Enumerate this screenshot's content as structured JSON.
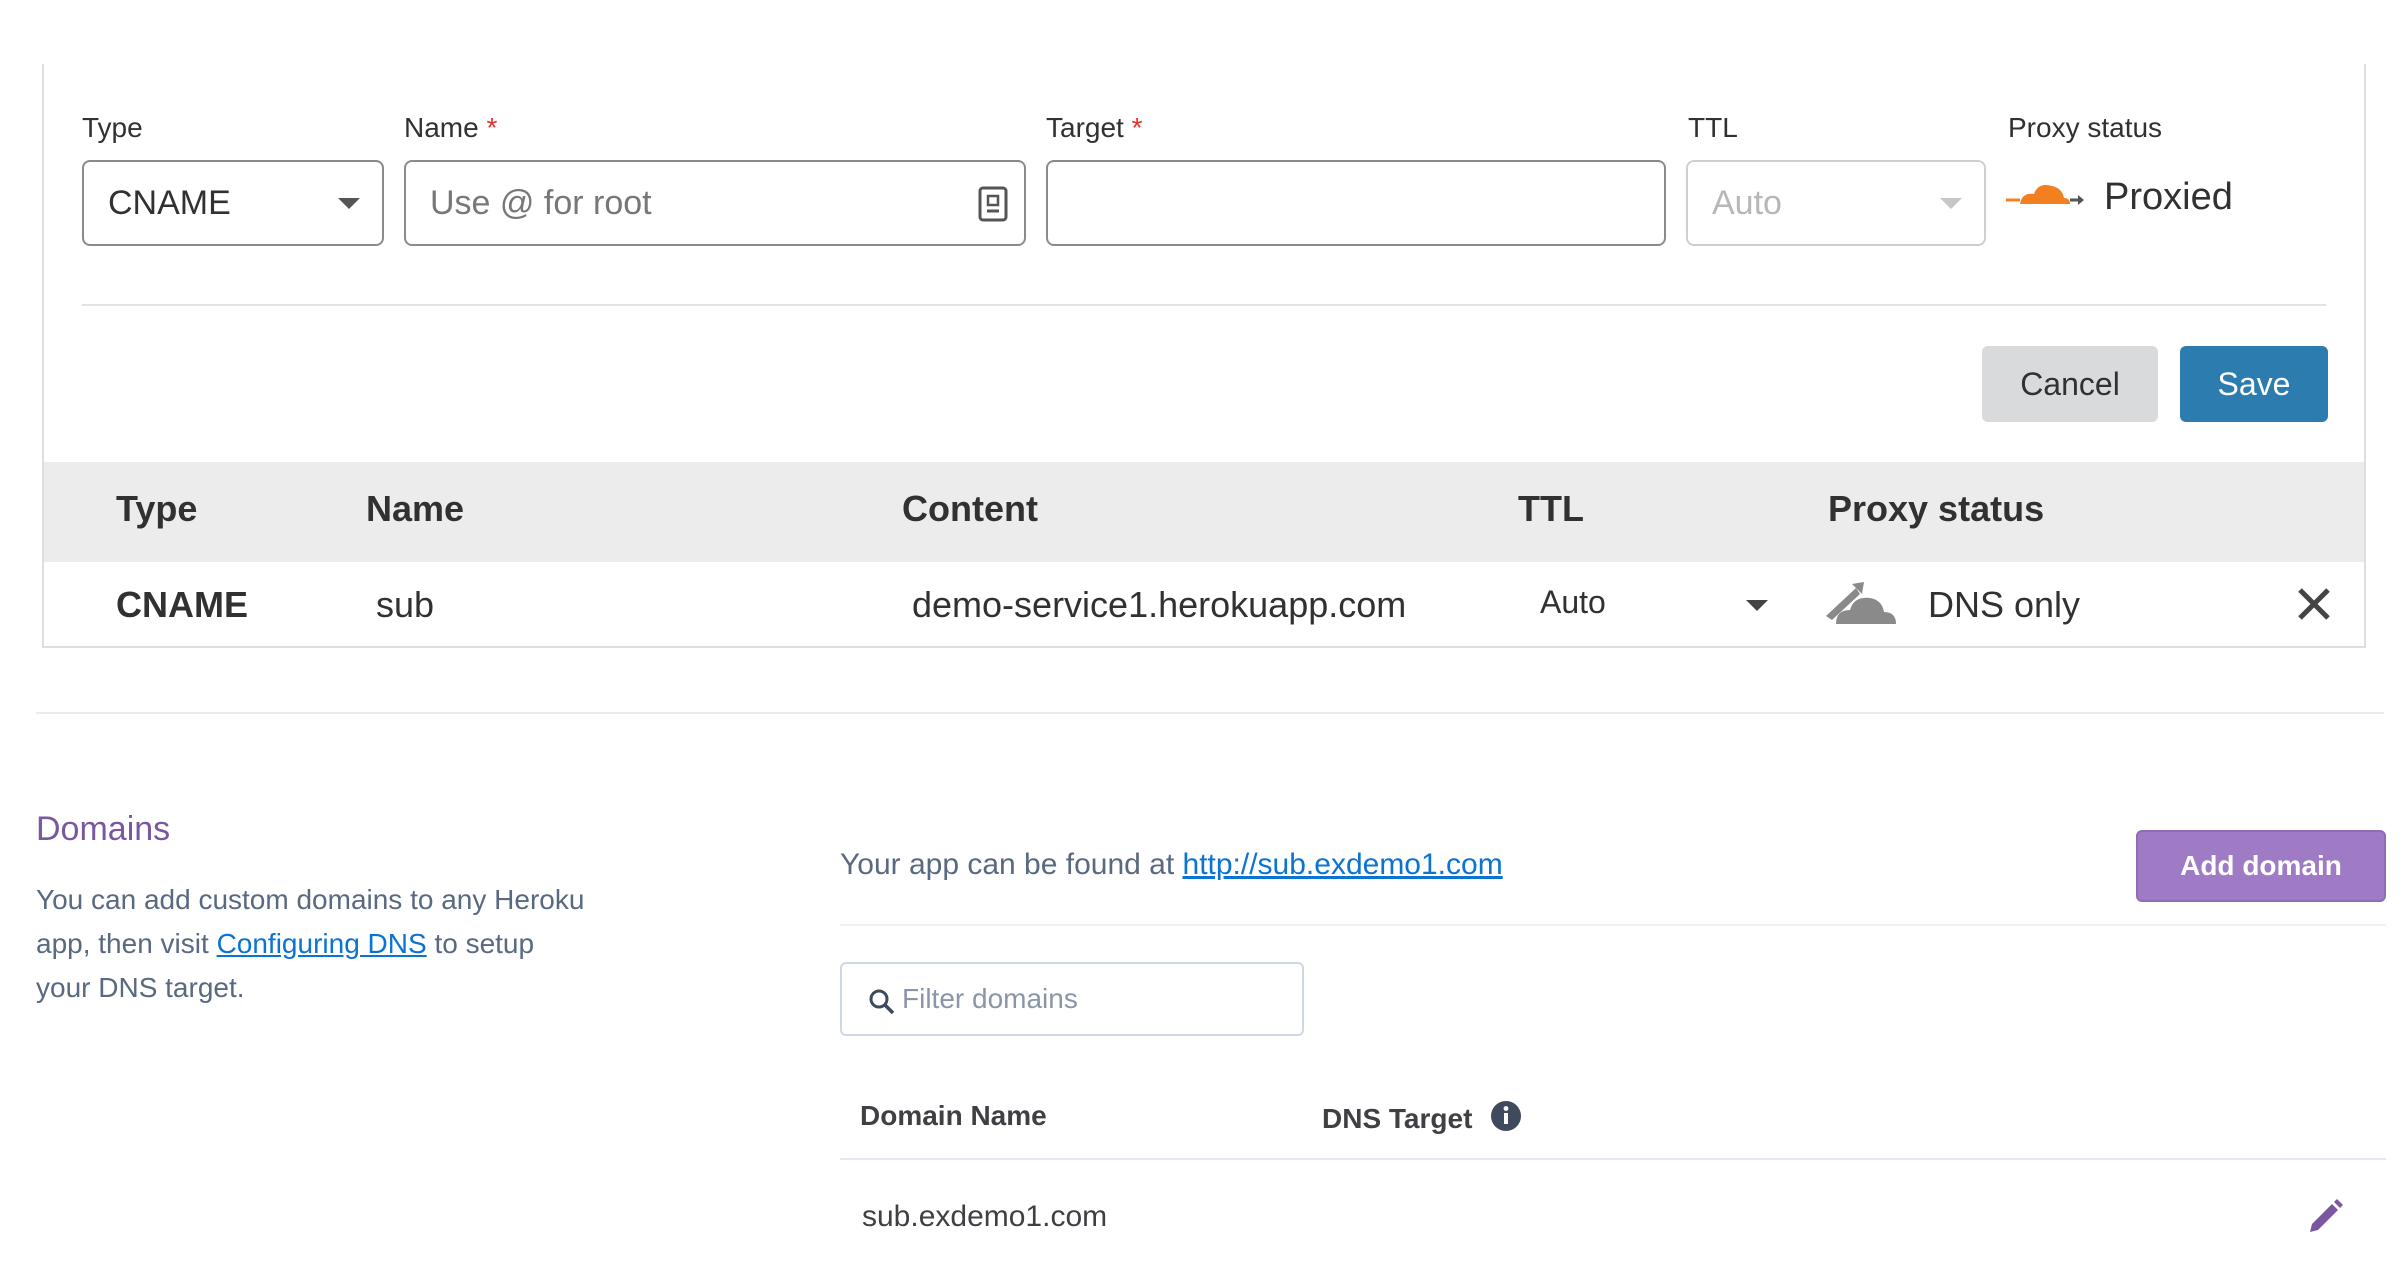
{
  "form": {
    "type_label": "Type",
    "type_value": "CNAME",
    "name_label": "Name",
    "name_placeholder": "Use @ for root",
    "target_label": "Target",
    "target_value": "",
    "ttl_label": "TTL",
    "ttl_value": "Auto",
    "proxy_label": "Proxy status",
    "proxy_value": "Proxied",
    "required_mark": "*",
    "cancel_label": "Cancel",
    "save_label": "Save"
  },
  "records_table": {
    "headers": [
      "Type",
      "Name",
      "Content",
      "TTL",
      "Proxy status"
    ],
    "rows": [
      {
        "type": "CNAME",
        "name": "sub",
        "content": "demo-service1.herokuapp.com",
        "ttl": "Auto",
        "proxy": "DNS only"
      }
    ]
  },
  "heroku": {
    "title": "Domains",
    "desc_before": "You can add custom domains to any Heroku app, then visit ",
    "desc_link": "Configuring DNS",
    "desc_after": " to setup your DNS target.",
    "found_text": "Your app can be found at ",
    "found_link": "http://sub.exdemo1.com",
    "add_domain_label": "Add domain",
    "filter_placeholder": "Filter domains",
    "col_domain_name": "Domain Name",
    "col_dns_target": "DNS Target",
    "domains": [
      {
        "name": "sub.exdemo1.com",
        "dns_target": ""
      }
    ]
  },
  "colors": {
    "save_blue": "#2c7cb0",
    "heroku_purple": "#79589f",
    "cloud_orange": "#f38020",
    "link_blue": "#0b73d2"
  }
}
